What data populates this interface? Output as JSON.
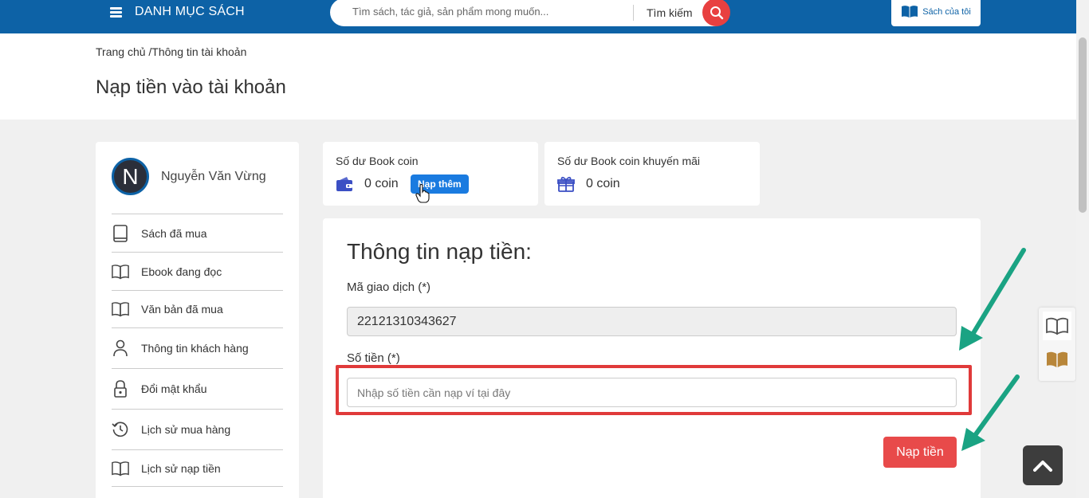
{
  "header": {
    "menu_label": "DANH MỤC SÁCH",
    "search_placeholder": "Tìm sách, tác giả, sản phẩm mong muốn...",
    "search_label": "Tìm kiếm",
    "my_books_label": "Sách của tôi"
  },
  "breadcrumb": {
    "home": "Trang chủ",
    "separator": " /",
    "current": "Thông tin tài khoản"
  },
  "page_title": "Nạp tiền vào tài khoản",
  "profile": {
    "avatar_initial": "N",
    "name": "Nguyễn Văn Vừng"
  },
  "sidebar": {
    "items": [
      {
        "label": "Sách đã mua",
        "icon": "book-closed-icon"
      },
      {
        "label": "Ebook đang đọc",
        "icon": "book-open-icon"
      },
      {
        "label": "Văn bản đã mua",
        "icon": "book-open-icon"
      },
      {
        "label": "Thông tin khách hàng",
        "icon": "user-icon"
      },
      {
        "label": "Đổi mật khẩu",
        "icon": "lock-icon"
      },
      {
        "label": "Lịch sử mua hàng",
        "icon": "history-icon"
      },
      {
        "label": "Lịch sử nạp tiền",
        "icon": "book-open-icon"
      }
    ]
  },
  "balance": {
    "main_title": "Số dư Book coin",
    "main_value": "0 coin",
    "topup_label": "Nạp thêm",
    "promo_title": "Số dư Book coin khuyến mãi",
    "promo_value": "0 coin"
  },
  "form": {
    "title": "Thông tin nạp tiền:",
    "txn_label": "Mã giao dịch (*)",
    "txn_value": "22121310343627",
    "amount_label": "Số tiền (*)",
    "amount_placeholder": "Nhập số tiền cần nạp ví tại đây",
    "amount_value": "",
    "submit_label": "Nạp tiền"
  },
  "colors": {
    "header": "#0d62a6",
    "search_button": "#e84040",
    "submit_button": "#e84a4a",
    "topup_button": "#1a7be0",
    "highlight": "#e03a3a",
    "arrow": "#1aa383"
  }
}
